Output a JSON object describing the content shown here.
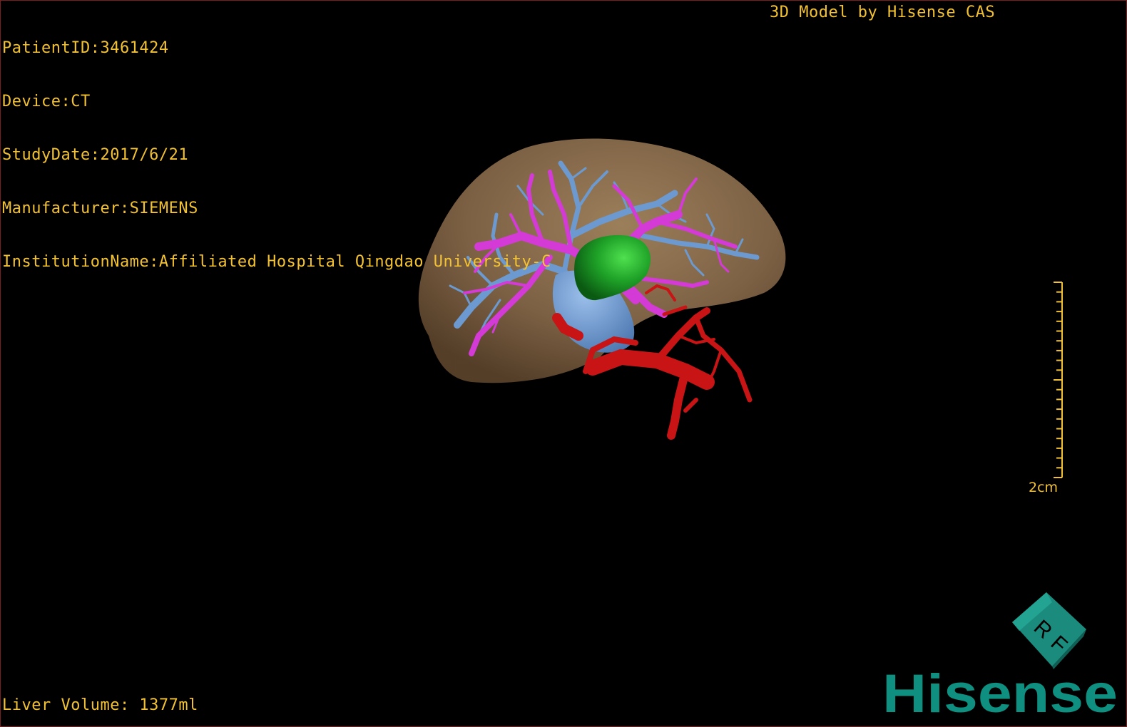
{
  "overlay": {
    "info_lines": [
      "PatientID:3461424",
      "Device:CT",
      "StudyDate:2017/6/21",
      "Manufacturer:SIEMENS",
      "InstitutionName:Affiliated Hospital Qingdao University-C"
    ],
    "credit": "3D Model by Hisense CAS",
    "volume": "Liver Volume: 1377ml",
    "scale_label": "2cm",
    "text_color": "#f2c233"
  },
  "orientation_cube": {
    "face_letters": [
      "R",
      "F"
    ],
    "color": "#1b8b7d"
  },
  "brand": {
    "logo_text": "Hisense",
    "color": "#0e8f80"
  },
  "model": {
    "structures": [
      {
        "name": "liver-parenchyma",
        "color": "#8a6e4a"
      },
      {
        "name": "hepatic-vein",
        "color": "#6c9ad0"
      },
      {
        "name": "portal-vein",
        "color": "#d43ad6"
      },
      {
        "name": "tumor",
        "color": "#1fa228"
      },
      {
        "name": "hepatic-artery",
        "color": "#c81414"
      },
      {
        "name": "inferior-vena-cava",
        "color": "#6f99d3"
      }
    ]
  }
}
